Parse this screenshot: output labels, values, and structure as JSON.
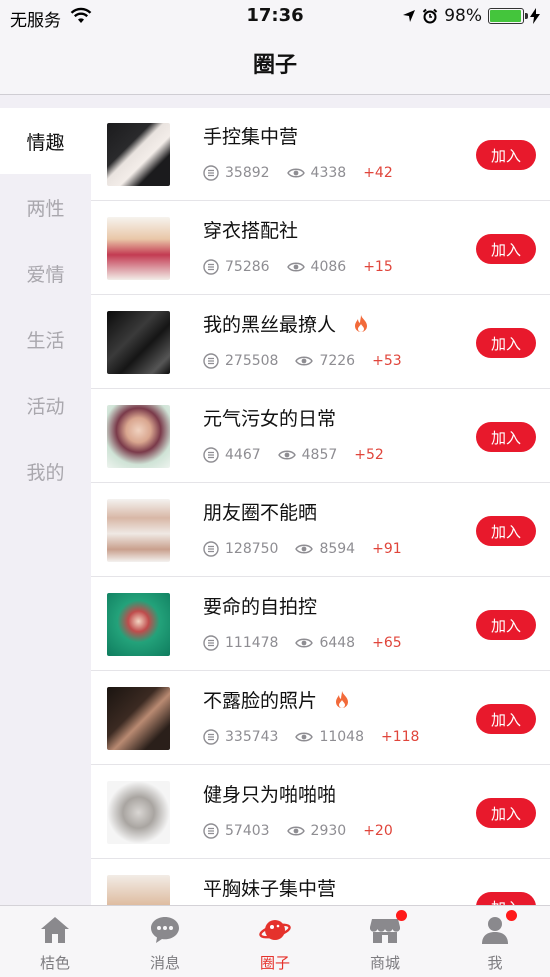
{
  "status_bar": {
    "carrier": "无服务",
    "time": "17:36",
    "battery": "98%",
    "battery_fraction": 0.98
  },
  "nav": {
    "title": "圈子"
  },
  "sidebar": {
    "items": [
      {
        "label": "情趣",
        "active": true
      },
      {
        "label": "两性",
        "active": false
      },
      {
        "label": "爱情",
        "active": false
      },
      {
        "label": "生活",
        "active": false
      },
      {
        "label": "活动",
        "active": false
      },
      {
        "label": "我的",
        "active": false
      }
    ]
  },
  "circles": [
    {
      "title": "手控集中营",
      "posts": "35892",
      "views": "4338",
      "delta": "+42",
      "hot": false,
      "join": "加入"
    },
    {
      "title": "穿衣搭配社",
      "posts": "75286",
      "views": "4086",
      "delta": "+15",
      "hot": false,
      "join": "加入"
    },
    {
      "title": "我的黑丝最撩人",
      "posts": "275508",
      "views": "7226",
      "delta": "+53",
      "hot": true,
      "join": "加入"
    },
    {
      "title": "元气污女的日常",
      "posts": "4467",
      "views": "4857",
      "delta": "+52",
      "hot": false,
      "join": "加入"
    },
    {
      "title": "朋友圈不能晒",
      "posts": "128750",
      "views": "8594",
      "delta": "+91",
      "hot": false,
      "join": "加入"
    },
    {
      "title": "要命的自拍控",
      "posts": "111478",
      "views": "6448",
      "delta": "+65",
      "hot": false,
      "join": "加入"
    },
    {
      "title": "不露脸的照片",
      "posts": "335743",
      "views": "11048",
      "delta": "+118",
      "hot": true,
      "join": "加入"
    },
    {
      "title": "健身只为啪啪啪",
      "posts": "57403",
      "views": "2930",
      "delta": "+20",
      "hot": false,
      "join": "加入"
    },
    {
      "title": "平胸妹子集中营",
      "posts": "",
      "views": "",
      "delta": "",
      "hot": false,
      "join": "加入"
    }
  ],
  "tabbar": {
    "tabs": [
      {
        "label": "桔色",
        "icon": "home-icon",
        "active": false,
        "badge": false
      },
      {
        "label": "消息",
        "icon": "chat-bubble-icon",
        "active": false,
        "badge": false
      },
      {
        "label": "圈子",
        "icon": "planet-icon",
        "active": true,
        "badge": false
      },
      {
        "label": "商城",
        "icon": "store-icon",
        "active": false,
        "badge": true
      },
      {
        "label": "我",
        "icon": "person-icon",
        "active": false,
        "badge": true
      }
    ]
  },
  "colors": {
    "accent": "#e8192c",
    "delta": "#e0453b",
    "active_tab": "#e5322c",
    "battery": "#44c53c"
  }
}
